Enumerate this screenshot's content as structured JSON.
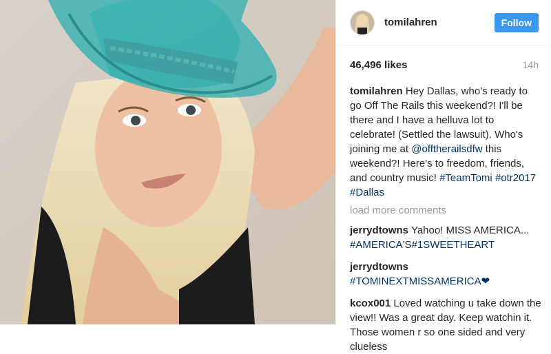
{
  "post": {
    "username": "tomilahren",
    "follow_label": "Follow",
    "likes": "46,496 likes",
    "time": "14h"
  },
  "caption": {
    "username": "tomilahren",
    "text1": "Hey Dallas, who's ready to go Off The Rails this weekend?! I'll be there and I have a helluva lot to celebrate! (Settled the lawsuit). Who's joining me at",
    "mention": "@offtherailsdfw",
    "text2": "this weekend?! Here's to freedom, friends, and country music!",
    "tag1": "#TeamTomi",
    "tag2": "#otr2017",
    "tag3": "#Dallas"
  },
  "load_more": "load more comments",
  "comments": [
    {
      "username": "jerrydtowns",
      "text": "Yahoo! MISS AMERICA...",
      "tag1": "#AMERICA",
      "mid": "'S",
      "tag2": "#1SWEETHEART"
    },
    {
      "username": "jerrydtowns",
      "tag": "#TOMINEXTMISSAMERICA",
      "emoji": "❤"
    },
    {
      "username": "kcox001",
      "text": "Loved watching u take down the view!! Was a great day. Keep watchin it. Those women r so one sided and very clueless"
    }
  ],
  "colors": {
    "follow": "#3897f0",
    "link": "#003569",
    "muted": "#999999"
  }
}
